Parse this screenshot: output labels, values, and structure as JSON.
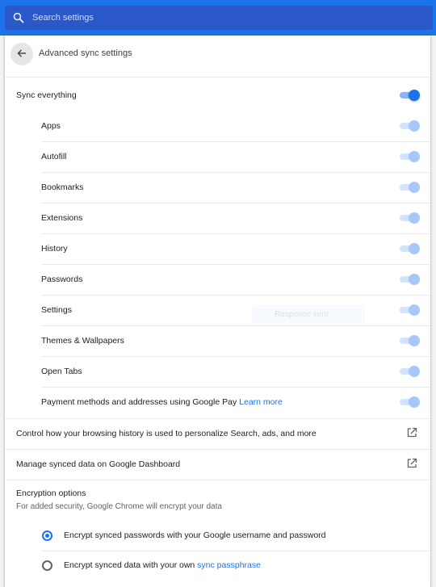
{
  "search": {
    "placeholder": "Search settings"
  },
  "header": {
    "title": "Advanced sync settings"
  },
  "sync_everything": {
    "label": "Sync everything",
    "enabled": true
  },
  "sync_items": [
    {
      "label": "Apps",
      "enabled": true
    },
    {
      "label": "Autofill",
      "enabled": true
    },
    {
      "label": "Bookmarks",
      "enabled": true
    },
    {
      "label": "Extensions",
      "enabled": true
    },
    {
      "label": "History",
      "enabled": true
    },
    {
      "label": "Passwords",
      "enabled": true
    },
    {
      "label": "Settings",
      "enabled": true
    },
    {
      "label": "Themes & Wallpapers",
      "enabled": true
    },
    {
      "label": "Open Tabs",
      "enabled": true
    },
    {
      "label": "Payment methods and addresses using Google Pay",
      "link": "Learn more",
      "enabled": true
    }
  ],
  "links": {
    "personalize": "Control how your browsing history is used to personalize Search, ads, and more",
    "dashboard": "Manage synced data on Google Dashboard"
  },
  "encryption": {
    "title": "Encryption options",
    "description": "For added security, Google Chrome will encrypt your data",
    "options": [
      {
        "label": "Encrypt synced passwords with your Google username and password",
        "checked": true
      },
      {
        "label": "Encrypt synced data with your own ",
        "link": "sync passphrase",
        "checked": false
      }
    ]
  },
  "toast": {
    "text": "Response sent"
  },
  "colors": {
    "accent": "#1a73e8",
    "header_bg": "#1a73e8",
    "toggle_dim": "#a8c7fa"
  }
}
